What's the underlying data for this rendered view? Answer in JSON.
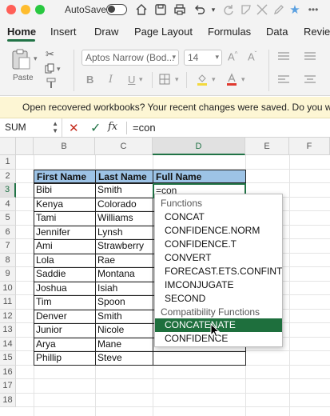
{
  "titlebar": {
    "autosave_label": "AutoSave",
    "traffic_colors": [
      "#ff5f57",
      "#febc2e",
      "#28c840"
    ]
  },
  "tabs": [
    {
      "label": "Home",
      "active": true
    },
    {
      "label": "Insert"
    },
    {
      "label": "Draw"
    },
    {
      "label": "Page Layout"
    },
    {
      "label": "Formulas"
    },
    {
      "label": "Data"
    },
    {
      "label": "Review"
    }
  ],
  "ribbon": {
    "paste_label": "Paste",
    "font_name": "Aptos Narrow (Bod...",
    "font_size": "14",
    "bold": "B",
    "italic": "I",
    "underline": "U"
  },
  "notice": {
    "text": "Open recovered workbooks?  Your recent changes were saved. Do you want"
  },
  "formula_bar": {
    "name_box": "SUM",
    "fx": "fx",
    "formula": "=con"
  },
  "columns": [
    "B",
    "C",
    "D",
    "E",
    "F"
  ],
  "rows": [
    "1",
    "2",
    "3",
    "4",
    "5",
    "6",
    "7",
    "8",
    "9",
    "10",
    "11",
    "12",
    "13",
    "14",
    "15",
    "16",
    "17",
    "18"
  ],
  "table": {
    "headers": [
      "First Name",
      "Last Name",
      "Full Name"
    ],
    "rows": [
      [
        "Bibi",
        "Smith"
      ],
      [
        "Kenya",
        "Colorado"
      ],
      [
        "Tami",
        "Williams"
      ],
      [
        "Jennifer",
        "Lynsh"
      ],
      [
        "Ami",
        "Strawberry"
      ],
      [
        "Lola",
        "Rae"
      ],
      [
        "Saddie",
        "Montana"
      ],
      [
        "Joshua",
        "Isiah"
      ],
      [
        "Tim",
        "Spoon"
      ],
      [
        "Denver",
        "Smith"
      ],
      [
        "Junior",
        "Nicole"
      ],
      [
        "Arya",
        "Mane"
      ],
      [
        "Phillip",
        "Steve"
      ]
    ],
    "active_cell_text": "=con"
  },
  "autocomplete": {
    "functions_header": "Functions",
    "functions": [
      "CONCAT",
      "CONFIDENCE.NORM",
      "CONFIDENCE.T",
      "CONVERT",
      "FORECAST.ETS.CONFINT",
      "IMCONJUGATE",
      "SECOND"
    ],
    "compat_header": "Compatibility Functions",
    "compat": [
      "CONCATENATE",
      "CONFIDENCE"
    ],
    "selected": "CONCATENATE"
  },
  "colors": {
    "accent": "#217346",
    "header_fill": "#9dc3e6",
    "notice_bg": "#fdf6d4",
    "selected_item": "#1e6f3d"
  }
}
